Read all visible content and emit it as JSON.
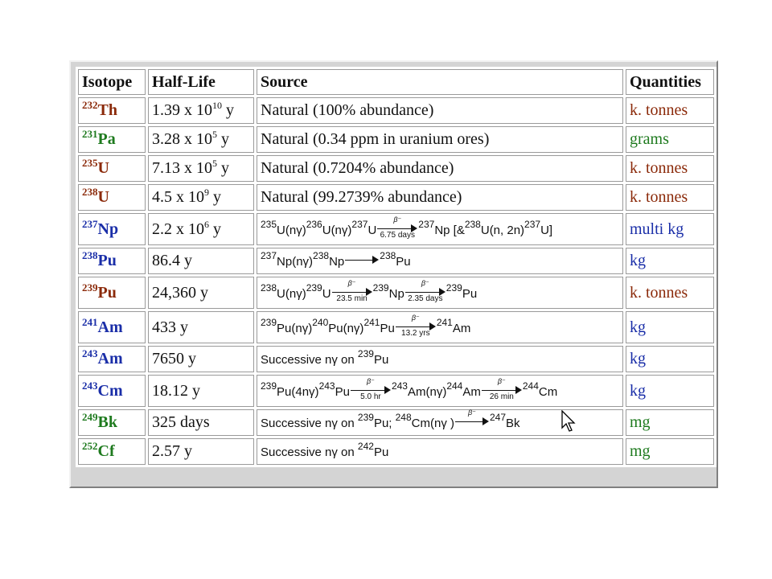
{
  "headers": {
    "isotope": "Isotope",
    "half_life": "Half-Life",
    "source": "Source",
    "quantities": "Quantities"
  },
  "colors": {
    "red": "#8b2a0a",
    "green": "#1e7a1e",
    "blue": "#1a2ea8"
  },
  "rows": [
    {
      "mass": "232",
      "el": "Th",
      "hl": "1.39 x 10",
      "hl_exp": "10",
      "hl_unit": "y",
      "src": "Natural (100% abundance)",
      "qty": "k. tonnes",
      "color": "red"
    },
    {
      "mass": "231",
      "el": "Pa",
      "hl": "3.28 x 10",
      "hl_exp": "5",
      "hl_unit": "y",
      "src": "Natural (0.34 ppm in uranium ores)",
      "qty": "grams",
      "color": "green"
    },
    {
      "mass": "235",
      "el": "U",
      "hl": "7.13 x 10",
      "hl_exp": "5",
      "hl_unit": "y",
      "src": "Natural (0.7204% abundance)",
      "qty": "k. tonnes",
      "color": "red"
    },
    {
      "mass": "238",
      "el": "U",
      "hl": "4.5 x 10",
      "hl_exp": "9",
      "hl_unit": "y",
      "src": "Natural (99.2739% abundance)",
      "qty": "k. tonnes",
      "color": "red"
    },
    {
      "mass": "237",
      "el": "Np",
      "hl": "2.2 x 10",
      "hl_exp": "6",
      "hl_unit": "y",
      "src_kind": "np237",
      "qty": "multi kg",
      "color": "blue"
    },
    {
      "mass": "238",
      "el": "Pu",
      "hl": "86.4 y",
      "src_kind": "pu238",
      "qty": "kg",
      "color": "blue"
    },
    {
      "mass": "239",
      "el": "Pu",
      "hl": "24,360 y",
      "src_kind": "pu239",
      "qty": "k. tonnes",
      "color": "red"
    },
    {
      "mass": "241",
      "el": "Am",
      "hl": "433 y",
      "src_kind": "am241",
      "qty": "kg",
      "color": "blue"
    },
    {
      "mass": "243",
      "el": "Am",
      "hl": "7650 y",
      "src_kind": "am243",
      "qty": "kg",
      "color": "blue"
    },
    {
      "mass": "243",
      "el": "Cm",
      "hl": "18.12 y",
      "src_kind": "cm243",
      "qty": "kg",
      "color": "blue"
    },
    {
      "mass": "249",
      "el": "Bk",
      "hl": "325 days",
      "src_kind": "bk249",
      "qty": "mg",
      "color": "green"
    },
    {
      "mass": "252",
      "el": "Cf",
      "hl": "2.57 y",
      "src_kind": "cf252",
      "qty": "mg",
      "color": "green"
    }
  ],
  "reactions": {
    "np237": {
      "a": "235",
      "b": "U(nγ)",
      "c": "236",
      "d": "U(nγ)",
      "e": "237",
      "f": "U",
      "arrow_top": "β⁻",
      "arrow_bot": "6.75 days",
      "g": "237",
      "h": "Np [&",
      "i": "238",
      "j": "U(n, 2n)",
      "k": "237",
      "l": "U]"
    },
    "pu238": {
      "a": "237",
      "b": "Np(nγ)",
      "c": "238",
      "d": "Np",
      "arrow_top": "",
      "e": "238",
      "f": "Pu"
    },
    "pu239": {
      "a": "238",
      "b": "U(nγ)",
      "c": "239",
      "d": "U",
      "arrow1_top": "β⁻",
      "arrow1_bot": "23.5 min",
      "e": "239",
      "f": "Np",
      "arrow2_top": "β⁻",
      "arrow2_bot": "2.35 days",
      "g": "239",
      "h": "Pu"
    },
    "am241": {
      "a": "239",
      "b": "Pu(nγ)",
      "c": "240",
      "d": "Pu(nγ)",
      "e": "241",
      "f": "Pu",
      "arrow_top": "β⁻",
      "arrow_bot": "13.2 yrs",
      "g": "241",
      "h": "Am"
    },
    "am243": {
      "a": "Successive nγ on",
      "b": "239",
      "c": "Pu"
    },
    "cm243": {
      "a": "239",
      "b": "Pu(4nγ)",
      "c": "243",
      "d": "Pu",
      "arrow1_top": "β⁻",
      "arrow1_bot": "5.0 hr",
      "e": "243",
      "f": "Am(nγ)",
      "g": "244",
      "h": "Am",
      "arrow2_top": "β⁻",
      "arrow2_bot": "26 min",
      "i": "244",
      "j": "Cm"
    },
    "bk249": {
      "a": "Successive nγ on",
      "b": "239",
      "c": "Pu;",
      "d": "248",
      "e": "Cm(nγ )",
      "arrow_top": "β⁻",
      "f": "247",
      "g": "Bk"
    },
    "cf252": {
      "a": "Successive nγ on",
      "b": "242",
      "c": "Pu"
    }
  }
}
